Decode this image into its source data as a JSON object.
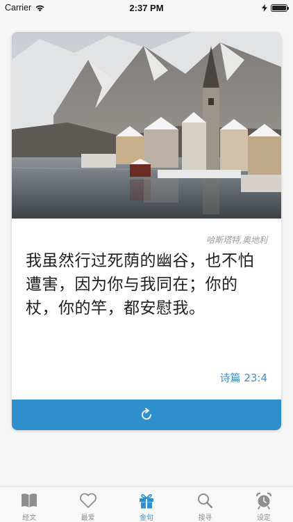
{
  "status_bar": {
    "carrier": "Carrier",
    "time": "2:37 PM",
    "icons": [
      "wifi-icon",
      "charging-icon",
      "battery-icon"
    ]
  },
  "card": {
    "image_caption": "哈斯塔特,奥地利",
    "verse_text": "我虽然行过死荫的幽谷，也不怕遭害，因为你与我同在；你的杖，你的竿，都安慰我。",
    "reference": "诗篇 23:4",
    "refresh_icon": "refresh-icon"
  },
  "tab_bar": {
    "tabs": [
      {
        "label": "经文",
        "icon": "book-icon",
        "active": false
      },
      {
        "label": "最爱",
        "icon": "heart-icon",
        "active": false
      },
      {
        "label": "金句",
        "icon": "gift-icon",
        "active": true
      },
      {
        "label": "搜寻",
        "icon": "search-icon",
        "active": false
      },
      {
        "label": "设定",
        "icon": "alarm-clock-icon",
        "active": false
      }
    ]
  },
  "colors": {
    "accent": "#2f8fcd",
    "reference_text": "#3e8fc4",
    "inactive_tab": "#8e8e8e",
    "background": "#f6f6f6"
  }
}
